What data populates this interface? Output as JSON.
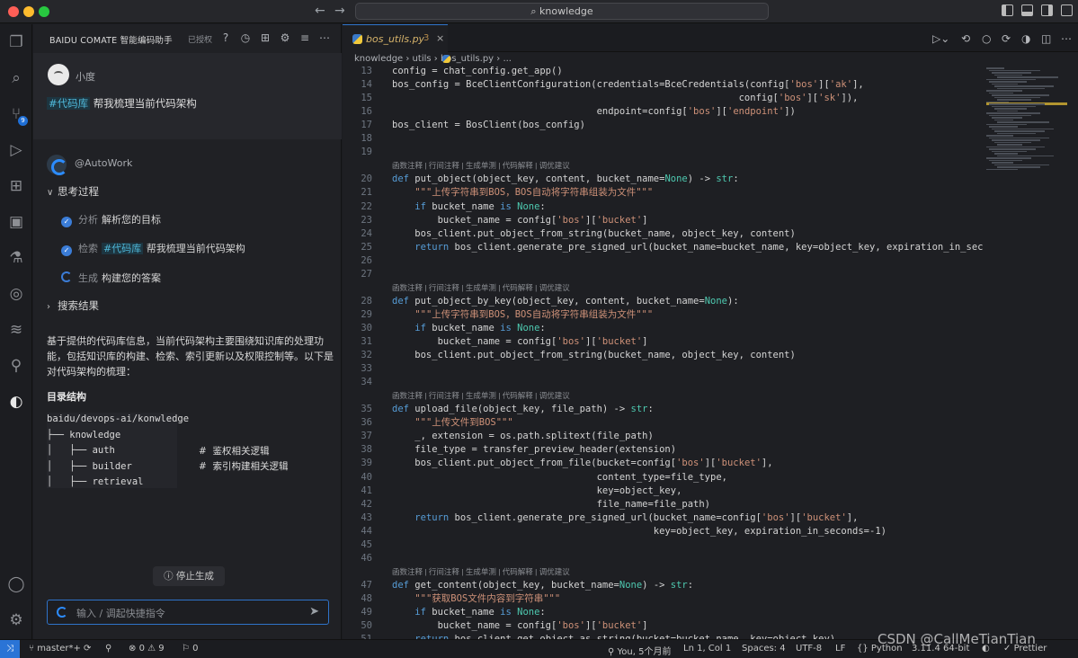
{
  "titlebar": {
    "search_text": "knowledge",
    "search_icon": "search-icon"
  },
  "activity_bar": {
    "scm_badge": "9"
  },
  "chat_panel": {
    "title": "BAIDU COMATE 智能编码助手",
    "auth_label": "已授权",
    "user_name": "小度",
    "user_message_tag": "#代码库",
    "user_message_text": " 帮我梳理当前代码架构",
    "bot_name": "@AutoWork",
    "thinking_label": "思考过程",
    "steps": [
      {
        "key": "分析",
        "text": "解析您的目标"
      },
      {
        "key": "检索",
        "tag": "#代码库",
        "text": " 帮我梳理当前代码架构"
      },
      {
        "key": "生成",
        "text": "构建您的答案"
      }
    ],
    "search_results_label": "搜索结果",
    "answer_paragraph": "基于提供的代码库信息，当前代码架构主要围绕知识库的处理功能，包括知识库的构建、检索、索引更新以及权限控制等。以下是对代码架构的梳理：",
    "structure_heading": "目录结构",
    "tree": [
      {
        "text": "baidu/devops-ai/konwledge",
        "comment": ""
      },
      {
        "text": "├── knowledge",
        "comment": ""
      },
      {
        "text": "│   ├── auth",
        "comment": "#  鉴权相关逻辑"
      },
      {
        "text": "│   ├── builder",
        "comment": "#  索引构建相关逻辑"
      },
      {
        "text": "│   ├── retrieval",
        "comment": ""
      }
    ],
    "stop_button": "停止生成",
    "input_placeholder": "输入 / 调起快捷指令"
  },
  "editor": {
    "tab": {
      "name": "bos_utils.py",
      "problems": "3"
    },
    "breadcrumb": "knowledge  ›  utils  ›      bos_utils.py  ›  ...",
    "code_lens": "函数注释 | 行间注释 | 生成单测 | 代码解释 | 调优建议",
    "lines": [
      {
        "n": "13",
        "t": "config = chat_config.get_app()"
      },
      {
        "n": "14",
        "t": "bos_config = BceClientConfiguration(credentials=BceCredentials(config['bos']['ak'],"
      },
      {
        "n": "15",
        "t": "                                                             config['bos']['sk']),"
      },
      {
        "n": "16",
        "t": "                                    endpoint=config['bos']['endpoint'])"
      },
      {
        "n": "17",
        "t": "bos_client = BosClient(bos_config)"
      },
      {
        "n": "18",
        "t": ""
      },
      {
        "n": "19",
        "t": ""
      },
      {
        "lens": true
      },
      {
        "n": "20",
        "t": "def put_object(object_key, content, bucket_name=None) -> str:"
      },
      {
        "n": "21",
        "t": "    \"\"\"上传字符串到BOS，BOS自动将字符串组装为文件\"\"\""
      },
      {
        "n": "22",
        "t": "    if bucket_name is None:"
      },
      {
        "n": "23",
        "t": "        bucket_name = config['bos']['bucket']"
      },
      {
        "n": "24",
        "t": "    bos_client.put_object_from_string(bucket_name, object_key, content)"
      },
      {
        "n": "25",
        "t": "    return bos_client.generate_pre_signed_url(bucket_name=bucket_name, key=object_key, expiration_in_seconds="
      },
      {
        "n": "26",
        "t": ""
      },
      {
        "n": "27",
        "t": ""
      },
      {
        "lens": true
      },
      {
        "n": "28",
        "t": "def put_object_by_key(object_key, content, bucket_name=None):"
      },
      {
        "n": "29",
        "t": "    \"\"\"上传字符串到BOS，BOS自动将字符串组装为文件\"\"\""
      },
      {
        "n": "30",
        "t": "    if bucket_name is None:"
      },
      {
        "n": "31",
        "t": "        bucket_name = config['bos']['bucket']"
      },
      {
        "n": "32",
        "t": "    bos_client.put_object_from_string(bucket_name, object_key, content)"
      },
      {
        "n": "33",
        "t": ""
      },
      {
        "n": "34",
        "t": ""
      },
      {
        "lens": true
      },
      {
        "n": "35",
        "t": "def upload_file(object_key, file_path) -> str:"
      },
      {
        "n": "36",
        "t": "    \"\"\"上传文件到BOS\"\"\""
      },
      {
        "n": "37",
        "t": "    _, extension = os.path.splitext(file_path)"
      },
      {
        "n": "38",
        "t": "    file_type = transfer_preview_header(extension)"
      },
      {
        "n": "39",
        "t": "    bos_client.put_object_from_file(bucket=config['bos']['bucket'],"
      },
      {
        "n": "40",
        "t": "                                    content_type=file_type,"
      },
      {
        "n": "41",
        "t": "                                    key=object_key,"
      },
      {
        "n": "42",
        "t": "                                    file_name=file_path)"
      },
      {
        "n": "43",
        "t": "    return bos_client.generate_pre_signed_url(bucket_name=config['bos']['bucket'],"
      },
      {
        "n": "44",
        "t": "                                              key=object_key, expiration_in_seconds=-1)"
      },
      {
        "n": "45",
        "t": ""
      },
      {
        "n": "46",
        "t": ""
      },
      {
        "lens": true
      },
      {
        "n": "47",
        "t": "def get_content(object_key, bucket_name=None) -> str:"
      },
      {
        "n": "48",
        "t": "    \"\"\"获取BOS文件内容到字符串\"\"\""
      },
      {
        "n": "49",
        "t": "    if bucket_name is None:"
      },
      {
        "n": "50",
        "t": "        bucket_name = config['bos']['bucket']"
      },
      {
        "n": "51",
        "t": "    return bos_client.get_object_as_string(bucket=bucket_name, key=object_key)"
      }
    ]
  },
  "statusbar": {
    "branch": "master*+",
    "errors": "0",
    "warnings": "9",
    "ports": "0",
    "blame": "You, 5个月前",
    "position": "Ln 1, Col 1",
    "spaces": "Spaces: 4",
    "encoding": "UTF-8",
    "eol": "LF",
    "language": "Python",
    "interpreter": "3.11.4 64-bit",
    "formatter": "Prettier"
  },
  "watermark": "CSDN @CallMeTianTian"
}
